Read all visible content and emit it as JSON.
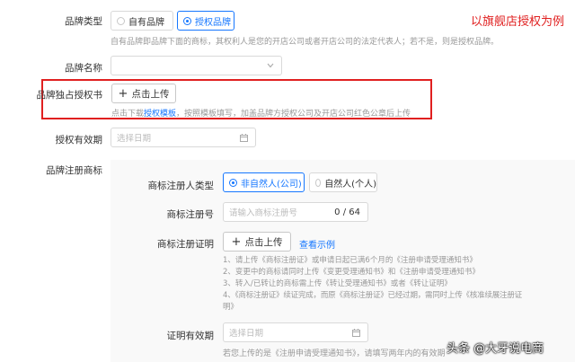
{
  "annotation": "以旗舰店授权为例",
  "brand_type": {
    "label": "品牌类型",
    "options": [
      "自有品牌",
      "授权品牌"
    ],
    "hint": "自有品牌即品牌下面的商标，其权利人是您的开店公司或者开店公司的法定代表人；若不是，则是授权品牌。"
  },
  "brand_name": {
    "label": "品牌名称",
    "placeholder": ""
  },
  "exclusive_auth": {
    "label": "品牌独占授权书",
    "upload_label": "点击上传",
    "hint_before": "点击下载",
    "hint_link": "授权模板",
    "hint_after": "，按照模板填写，加盖品牌方授权公司及开店公司红色公章后上传"
  },
  "auth_validity": {
    "label": "授权有效期",
    "placeholder": "选择日期"
  },
  "brand_trademark": {
    "label": "品牌注册商标"
  },
  "registrant_type": {
    "label": "商标注册人类型",
    "options": [
      "非自然人(公司)",
      "自然人(个人)"
    ]
  },
  "reg_number": {
    "label": "商标注册号",
    "placeholder": "请输入商标注册号",
    "counter": "0 / 64"
  },
  "reg_proof": {
    "label": "商标注册证明",
    "upload_label": "点击上传",
    "example_link": "查看示例",
    "steps": [
      "1、请上传《商标注册证》或申请日起已满6个月的《注册申请受理通知书》",
      "2、变更中的商标请同时上传《变更受理通知书》和《注册申请受理通知书》",
      "3、转入/已转让的商标需上传《转让受理通知书》或者《转让证明》",
      "4、《商标注册证》续证完成，而原《商标注册证》已经过期，需同时上传《核准续展注册证",
      "明》"
    ]
  },
  "proof_validity": {
    "label": "证明有效期",
    "placeholder": "选择日期",
    "hint": "若您上传的是《注册申请受理通知书》，请填写两年内的有效期"
  },
  "watermark": "头条 @大牙说电商",
  "colors": {
    "primary": "#1677ff",
    "highlight": "#e02020",
    "annotation": "#e02020"
  },
  "icons": [
    "chevron-down-icon",
    "calendar-icon",
    "plus-icon",
    "radio-icon"
  ]
}
